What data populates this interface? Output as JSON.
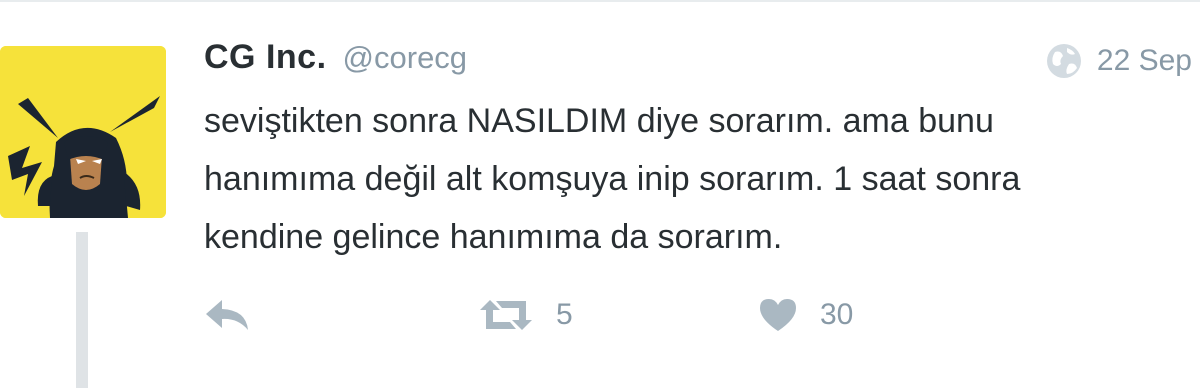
{
  "tweet": {
    "author_name": "CG Inc.",
    "author_handle": "@corecg",
    "timestamp": "22 Sep",
    "text": "seviştikten sonra NASILDIM diye sorarım. ama bunu\nhanımıma değil alt komşuya inip sorarım. 1 saat sonra\nkendine gelince hanımıma da sorarım.",
    "avatar_icon": "pikachu-batman-avatar",
    "avatar_bg_color": "#f6e23a"
  },
  "actions": {
    "reply_icon": "reply-icon",
    "retweet_icon": "retweet-icon",
    "retweet_count": "5",
    "like_icon": "heart-icon",
    "like_count": "30"
  },
  "colors": {
    "text": "#292f33",
    "muted": "#8899a6",
    "action_icon": "#aab8c2"
  }
}
